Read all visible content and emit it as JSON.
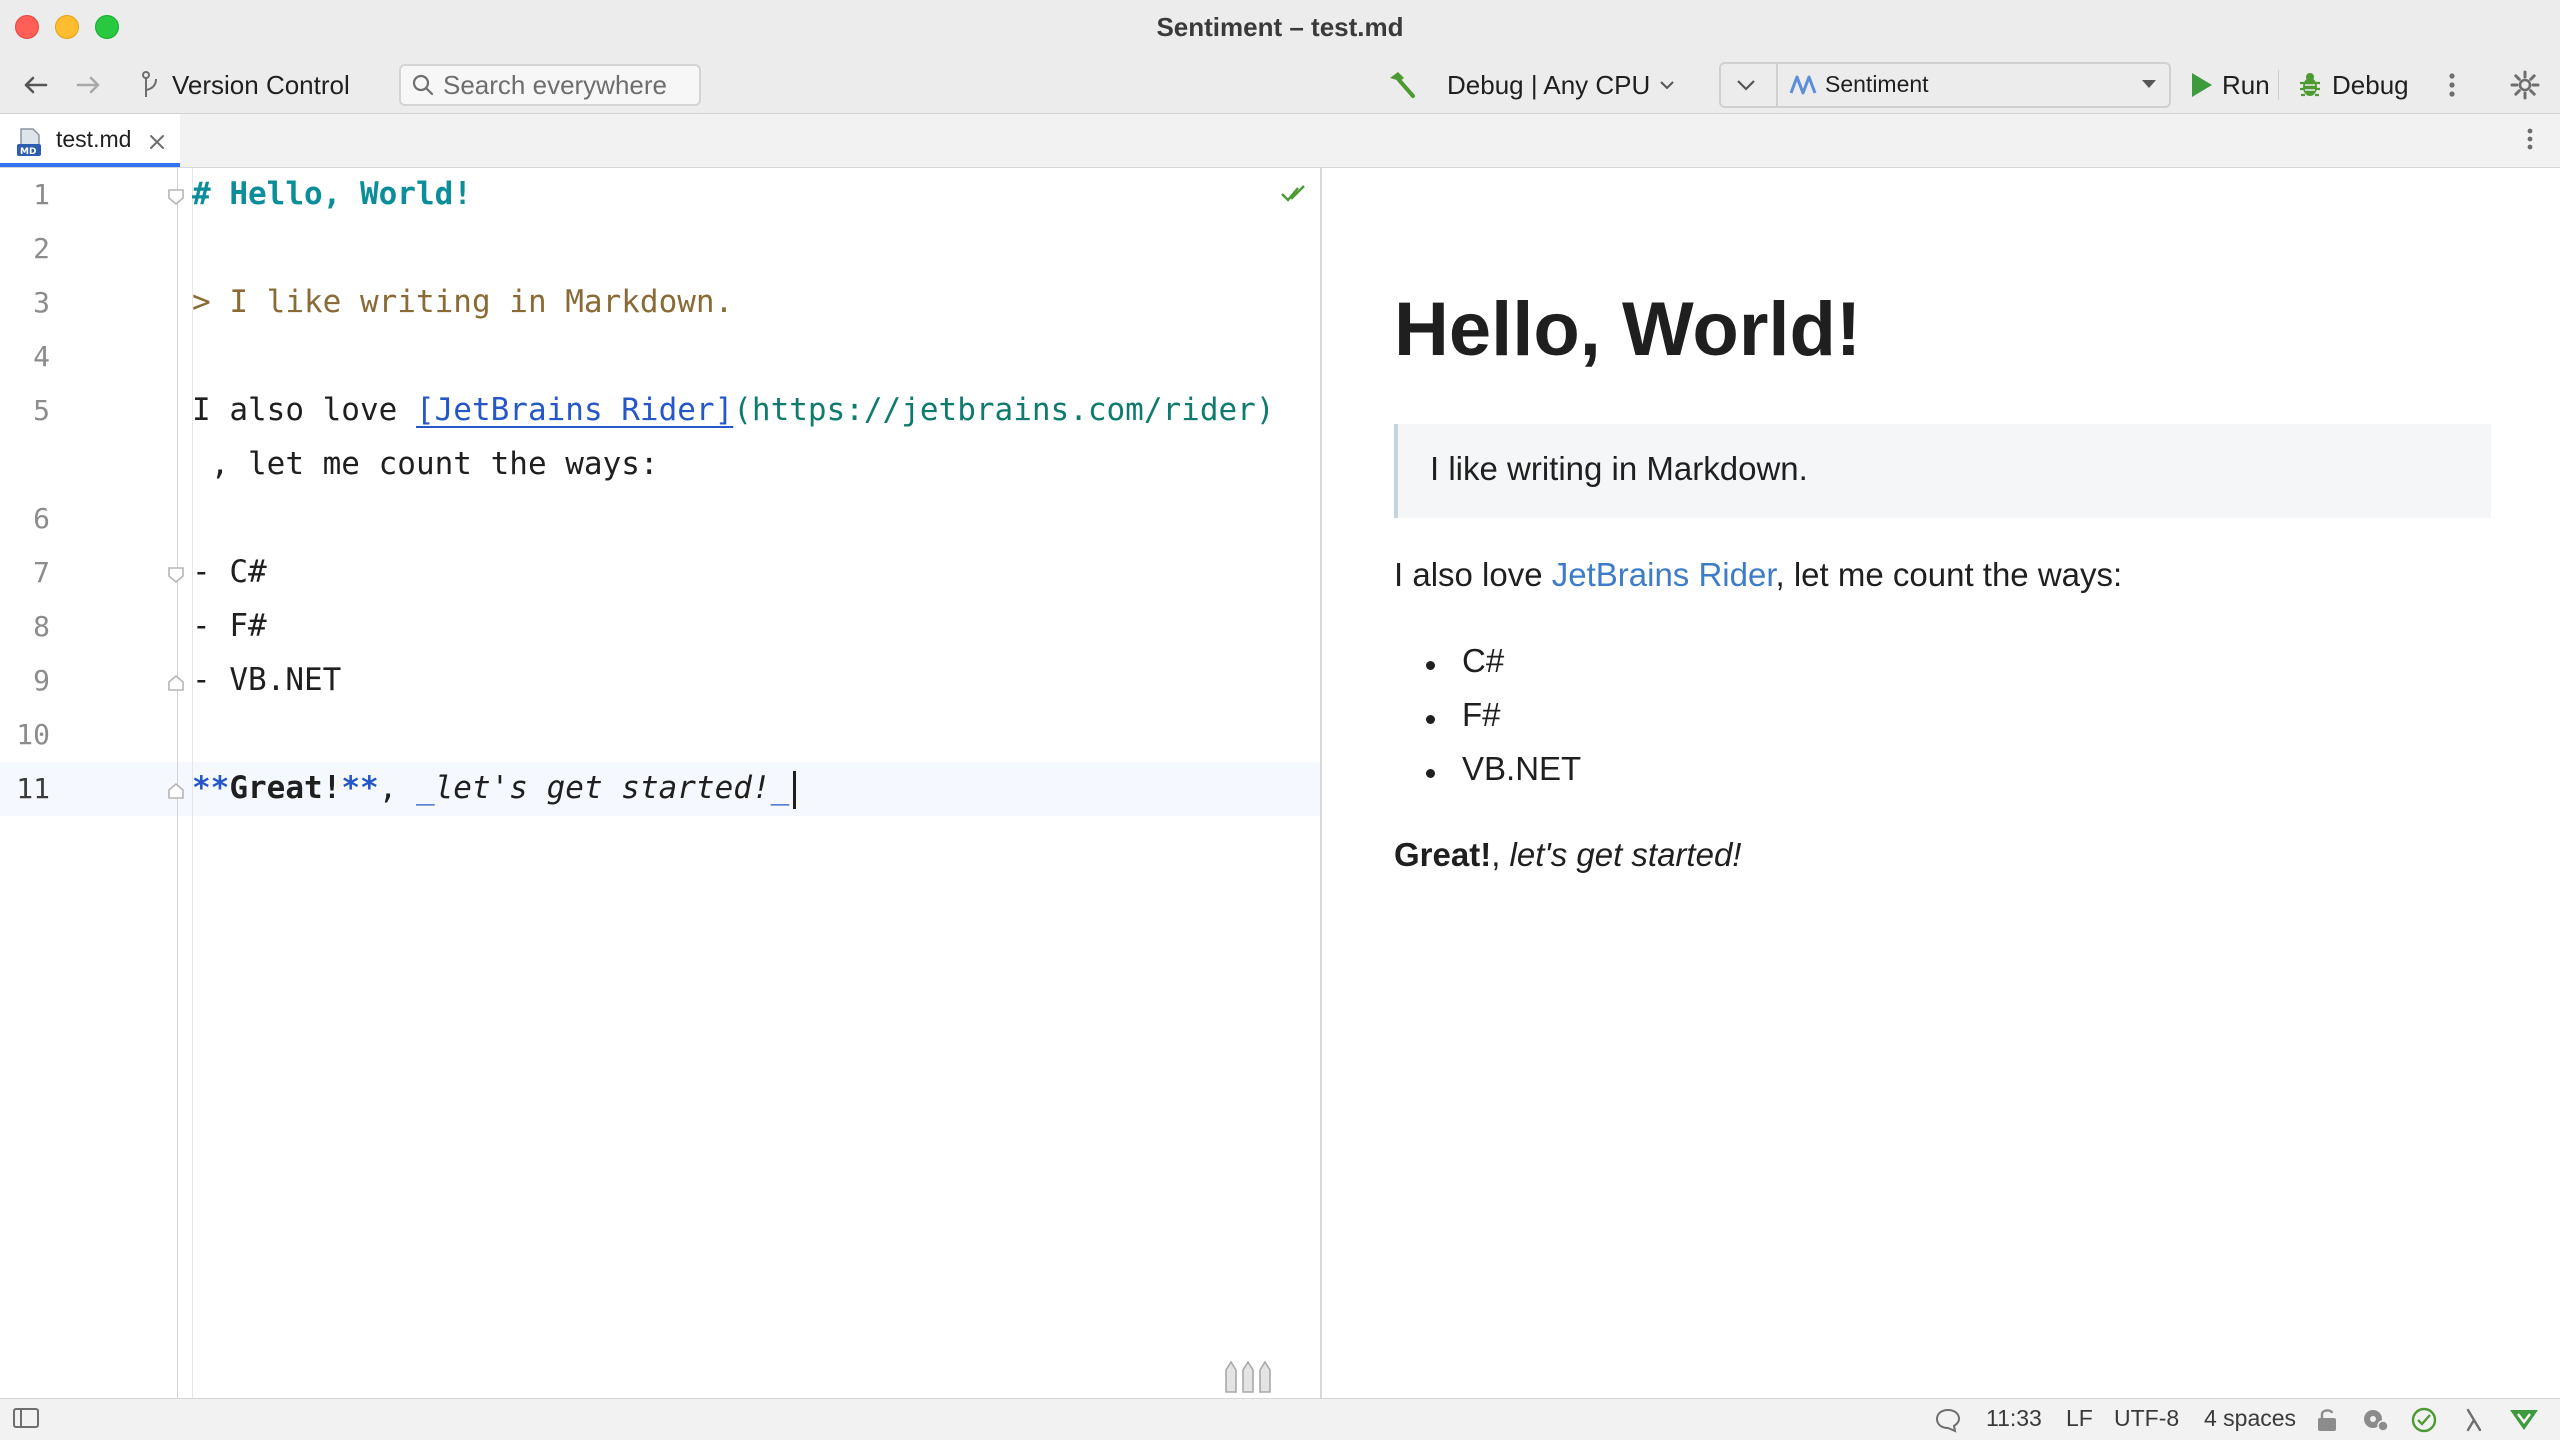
{
  "window": {
    "title": "Sentiment – test.md"
  },
  "toolbar": {
    "version_control": "Version Control",
    "search_placeholder": "Search everywhere",
    "build_config": "Debug | Any CPU",
    "run_config": "Sentiment",
    "run_label": "Run",
    "debug_label": "Debug"
  },
  "tabs": [
    {
      "label": "test.md",
      "active": true
    }
  ],
  "editor": {
    "line_numbers": [
      "1",
      "2",
      "3",
      "4",
      "5",
      "",
      "6",
      "7",
      "8",
      "9",
      "10",
      "11"
    ],
    "lines": {
      "l1_mark": "# ",
      "l1_text": "Hello, World!",
      "l3": "> I like writing in Markdown.",
      "l5_pre": "I also love ",
      "l5_link": "[JetBrains Rider]",
      "l5_url": "(https://jetbrains.com/rider)",
      "l5_wrap": " , let me count the ways:",
      "l7": "- C#",
      "l8": "- F#",
      "l9": "- VB.NET",
      "l11_bmark_open": "**",
      "l11_bold": "Great!",
      "l11_bmark_close": "**",
      "l11_sep": ", ",
      "l11_imark_open": "_",
      "l11_ital": "let's get started!",
      "l11_imark_close": "_"
    }
  },
  "preview": {
    "heading": "Hello, World!",
    "quote": "I like writing in Markdown.",
    "p1_pre": "I also love ",
    "p1_link": "JetBrains Rider",
    "p1_post": ", let me count the ways:",
    "list": [
      "C#",
      "F#",
      "VB.NET"
    ],
    "p2_bold": "Great!",
    "p2_sep": ", ",
    "p2_ital": "let's get started!"
  },
  "statusbar": {
    "position": "11:33",
    "line_ending": "LF",
    "encoding": "UTF-8",
    "indent": "4 spaces"
  },
  "colors": {
    "accent": "#3574f0",
    "heading_mark": "#0b8e9a",
    "quote": "#8a6a35",
    "link": "#2657c9",
    "url": "#0f7b6c",
    "run_green": "#3d9a3d"
  }
}
